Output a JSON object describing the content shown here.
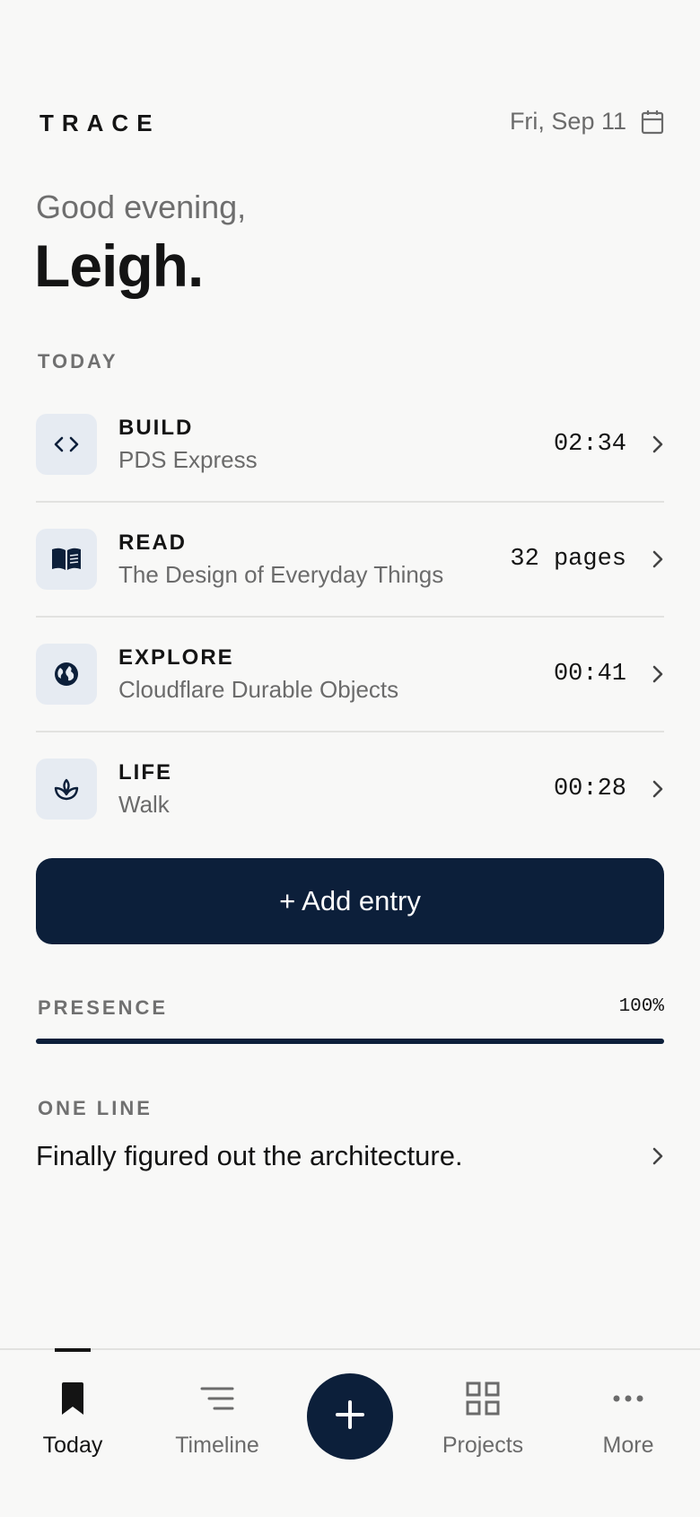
{
  "header": {
    "brand": "TRACE",
    "date": "Fri, Sep 11",
    "greeting": "Good evening,",
    "name": "Leigh."
  },
  "today": {
    "label": "TODAY",
    "entries": [
      {
        "category": "BUILD",
        "title": "PDS Express",
        "value": "02:34",
        "icon": "code-icon"
      },
      {
        "category": "READ",
        "title": "The Design of Everyday Things",
        "value": "32 pages",
        "icon": "book-icon"
      },
      {
        "category": "EXPLORE",
        "title": "Cloudflare Durable Objects",
        "value": "00:41",
        "icon": "globe-icon"
      },
      {
        "category": "LIFE",
        "title": "Walk",
        "value": "00:28",
        "icon": "sprout-icon"
      }
    ]
  },
  "add_button": "+ Add entry",
  "presence": {
    "label": "PRESENCE",
    "value": "100%",
    "fraction": 1.0
  },
  "one_line": {
    "label": "ONE LINE",
    "text": "Finally figured out the architecture."
  },
  "nav": {
    "today": "Today",
    "timeline": "Timeline",
    "projects": "Projects",
    "more": "More"
  },
  "colors": {
    "accent": "#0c1f3a",
    "background": "#f8f8f7",
    "icon_tile": "#e6ebf2"
  }
}
